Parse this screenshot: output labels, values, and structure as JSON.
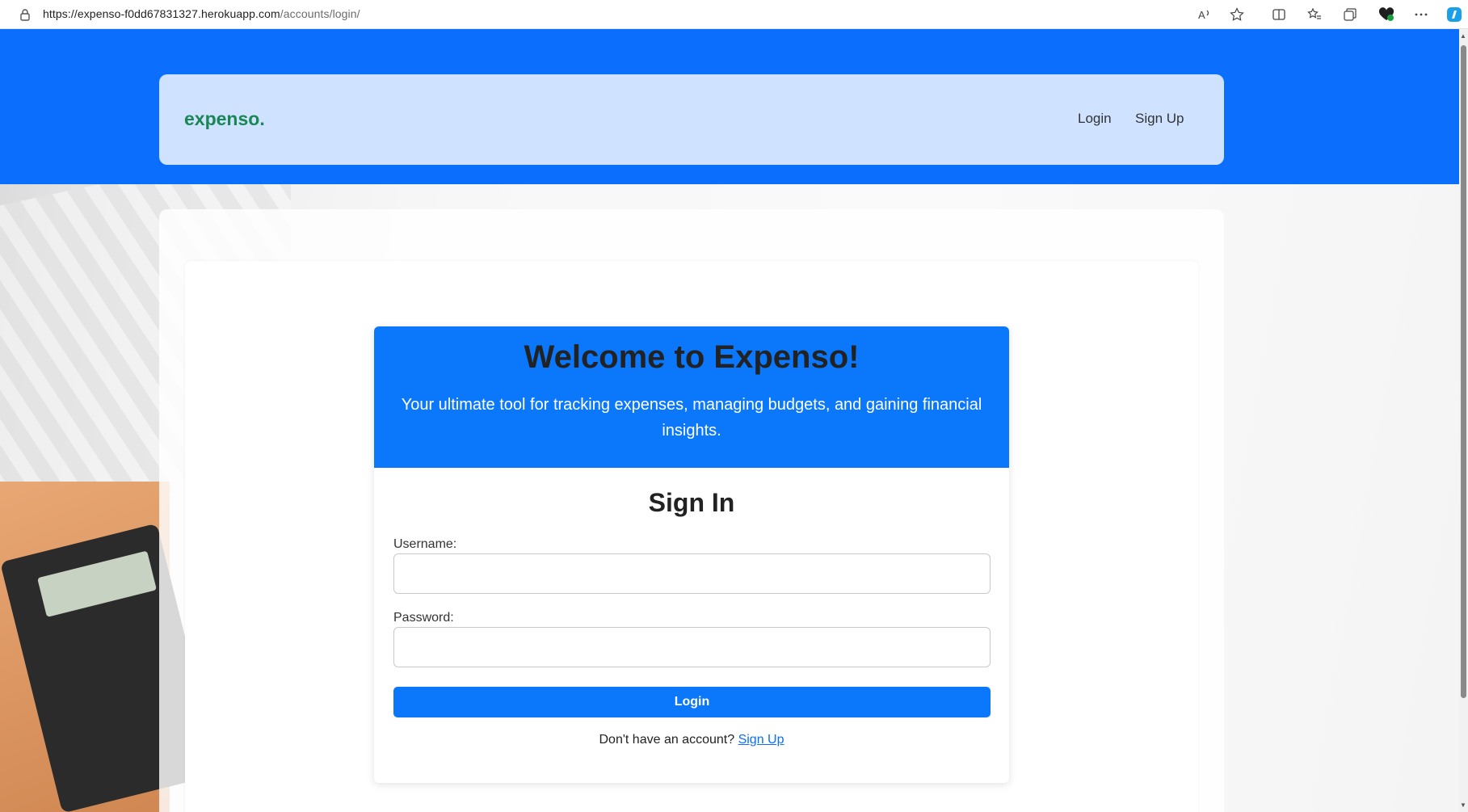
{
  "browser": {
    "url_host": "https://expenso-f0dd67831327.herokuapp.com",
    "url_path": "/accounts/login/",
    "icons": [
      "lock-icon",
      "read-aloud-icon",
      "favorite-star-icon",
      "split-screen-icon",
      "favorites-icon",
      "collections-icon",
      "browser-essentials-icon",
      "more-icon",
      "copilot-icon"
    ]
  },
  "navbar": {
    "brand": "expenso.",
    "links": [
      "Login",
      "Sign Up"
    ]
  },
  "hero": {
    "title": "Welcome to Expenso!",
    "subtitle": "Your ultimate tool for tracking expenses, managing budgets, and gaining financial insights."
  },
  "form": {
    "title": "Sign In",
    "username_label": "Username:",
    "username_value": "",
    "password_label": "Password:",
    "password_value": "",
    "submit_label": "Login",
    "signup_prompt": "Don't have an account?",
    "signup_link": "Sign Up"
  },
  "colors": {
    "primary": "#0b6efd",
    "nav_bg": "#cfe2ff",
    "brand": "#198754"
  }
}
